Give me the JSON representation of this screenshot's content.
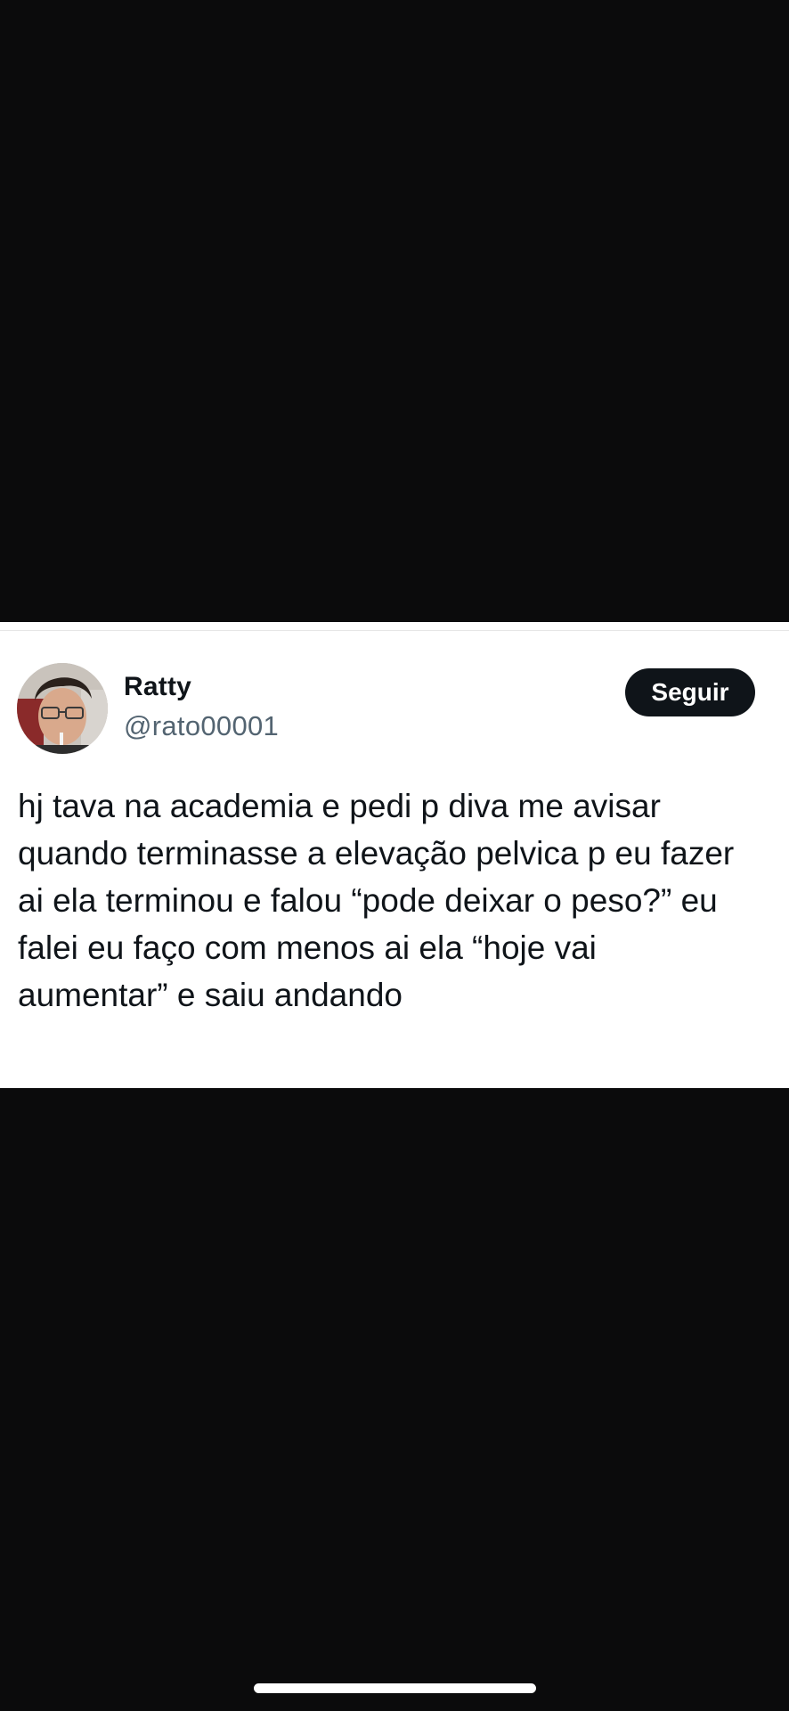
{
  "tweet": {
    "author": {
      "name": "Ratty",
      "handle": "@rato00001"
    },
    "follow_label": "Seguir",
    "lines": [
      "hj tava na academia e pedi p diva me avisar",
      "quando terminasse a elevação pelvica p eu fazer",
      "ai ela terminou e falou “pode deixar o peso?” eu",
      "falei eu faço com menos ai ela “hoje vai",
      "aumentar” e saiu andando"
    ]
  },
  "colors": {
    "background": "#0b0b0c",
    "card": "#ffffff",
    "text_primary": "#0f1419",
    "text_secondary": "#536471",
    "follow_button": "#0f1419"
  },
  "icons": {
    "avatar": "profile-photo"
  }
}
